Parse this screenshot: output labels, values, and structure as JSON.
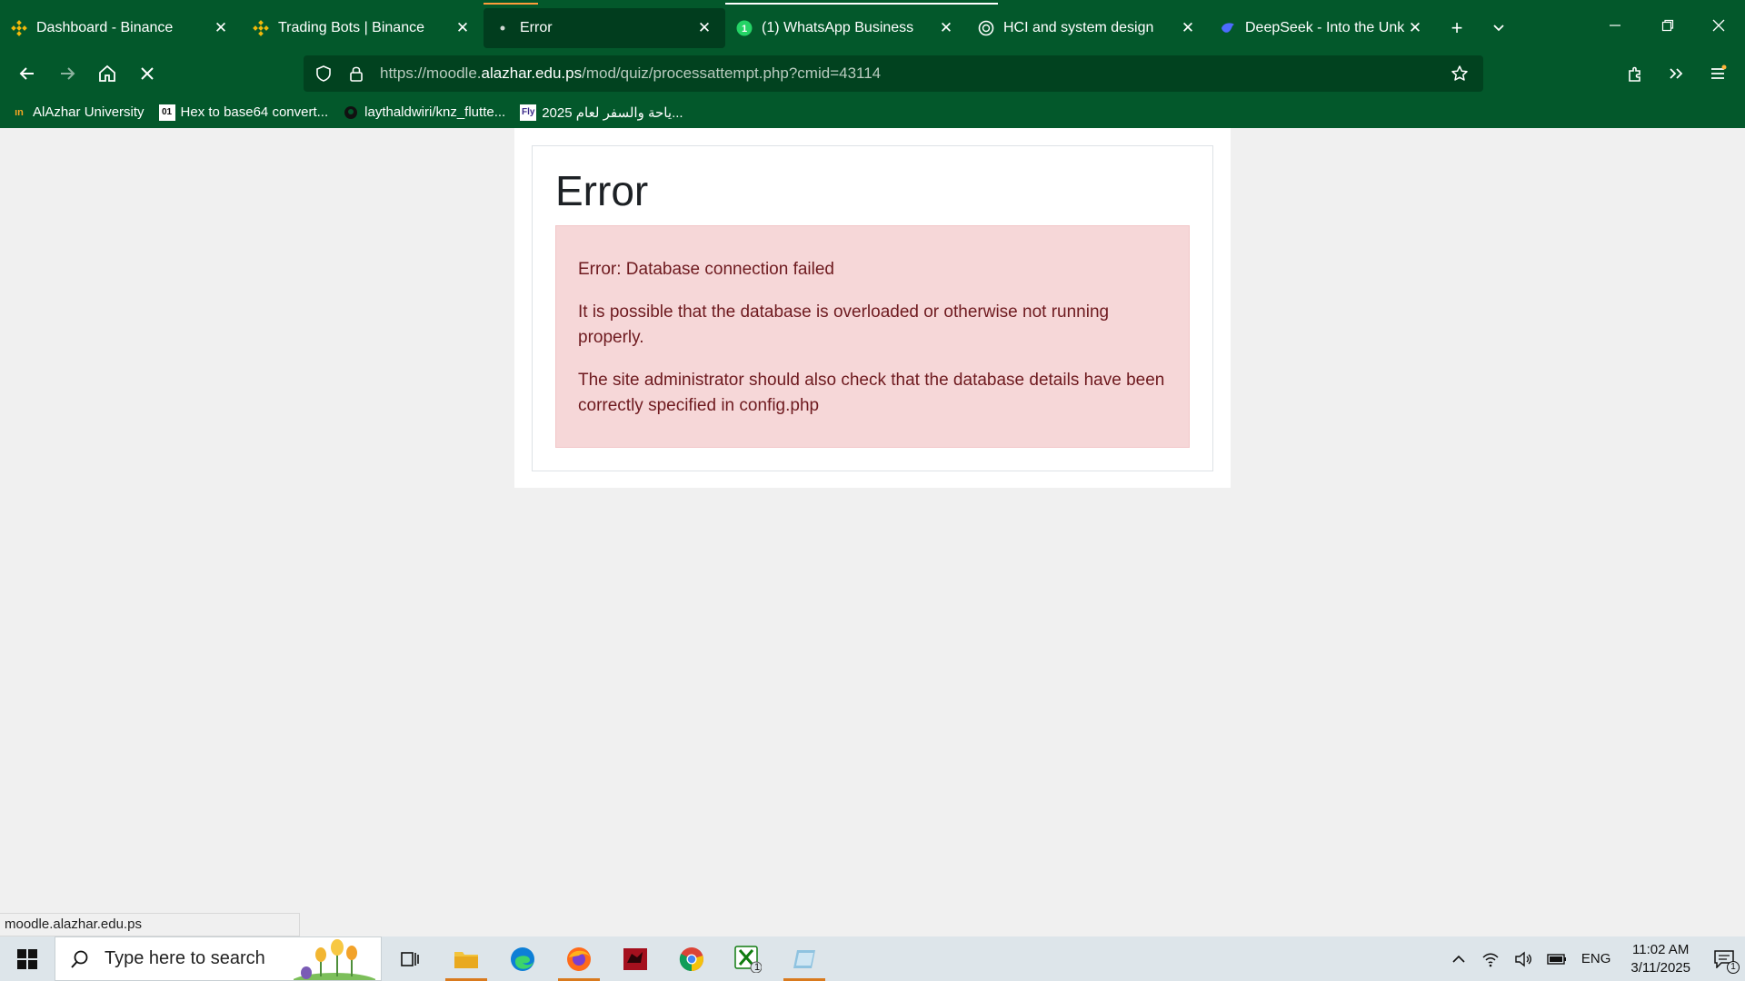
{
  "browser": {
    "tabs": [
      {
        "title": "Dashboard - Binance",
        "icon": "binance-icon"
      },
      {
        "title": "Trading Bots | Binance",
        "icon": "binance-icon"
      },
      {
        "title": "Error",
        "icon": "loading-dot-icon",
        "active": true
      },
      {
        "title": "(1) WhatsApp Business",
        "icon": "whatsapp-icon"
      },
      {
        "title": "HCI and system design",
        "icon": "openai-icon"
      },
      {
        "title": "DeepSeek - Into the Unknown",
        "icon": "deepseek-icon"
      }
    ],
    "url_prefix": "https://moodle.",
    "url_domain": "alazhar.edu.ps",
    "url_suffix": "/mod/quiz/processattempt.php?cmid=43114",
    "bookmarks": [
      {
        "label": "AlAzhar University",
        "icon": "alazhar-icon"
      },
      {
        "label": "Hex to base64 convert...",
        "icon": "hex-icon"
      },
      {
        "label": "laythaldwiri/knz_flutte...",
        "icon": "github-icon"
      },
      {
        "label": "2025 ياحة والسفر لعام...",
        "icon": "flag-icon"
      }
    ],
    "status_url": "moodle.alazhar.edu.ps"
  },
  "page": {
    "heading": "Error",
    "messages": [
      "Error: Database connection failed",
      "It is possible that the database is overloaded or otherwise not running properly.",
      "The site administrator should also check that the database details have been correctly specified in config.php"
    ]
  },
  "taskbar": {
    "search_placeholder": "Type here to search",
    "language": "ENG",
    "time": "11:02 AM",
    "date": "3/11/2025",
    "notification_count": "1",
    "xbox_badge": "1"
  },
  "colors": {
    "chrome": "#03582b",
    "urlbar": "#01421f",
    "alert_bg": "#f6d7d8",
    "alert_text": "#6e1a1f"
  }
}
